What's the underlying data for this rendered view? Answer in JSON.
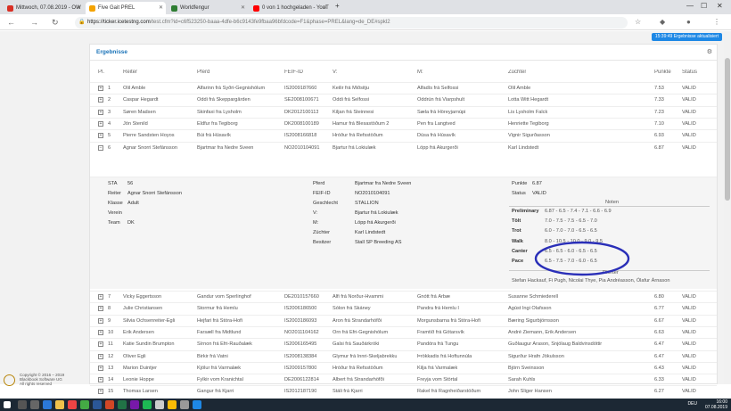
{
  "browser": {
    "tabs": [
      {
        "label": "Mittwoch, 07.08.2019 - OW",
        "color": "#d93025"
      },
      {
        "label": "Five Gait PREL",
        "color": "#f4a300",
        "active": true
      },
      {
        "label": "Worldfengur",
        "color": "#2e7d32"
      },
      {
        "label": "0 von 1 hochgeladen - YouT",
        "color": "#ff0000"
      }
    ],
    "new_tab": "+",
    "url_host": "https://ticker.icetestng.com",
    "url_path": "/test.cfm?id=c6f523250-baaa-4dfe-b6c9143fe9fbaa96bfdcode=F1&phase=PREL&lang=de_DE#spkl2",
    "back": "←",
    "forward": "→",
    "reload": "↻"
  },
  "status_badge": "15:39:49 Ergebnisse aktualisiert",
  "panel": {
    "title": "Ergebnisse",
    "gear": "⚙"
  },
  "columns": [
    "Pl.",
    "Reiter",
    "Pferd",
    "FEIF-ID",
    "V:",
    "M:",
    "Züchter",
    "Punkte",
    "Status"
  ],
  "rows_top": [
    {
      "pl": "1",
      "reiter": "Olil Amble",
      "pferd": "Álfarinn frá Syðri-Gegnishólum",
      "feif": "IS2009187660",
      "v": "Keilir frá Miðsitju",
      "m": "Álfadís frá Selfossi",
      "zuchter": "Olil Amble",
      "punkte": "7.53",
      "status": "VALID"
    },
    {
      "pl": "2",
      "reiter": "Caspar Hegardt",
      "pferd": "Oddi frá Skeppargården",
      "feif": "SE2008100671",
      "v": "Oddi frá Selfossi",
      "m": "Oddrún frá Viarpshult",
      "zuchter": "Lotta Witt Hegardt",
      "punkte": "7.33",
      "status": "VALID"
    },
    {
      "pl": "3",
      "reiter": "Søren Madsen",
      "pferd": "Skinfaxi fra Lysholm",
      "feif": "DK2012100113",
      "v": "Kiljan frá Steinnesi",
      "m": "Sæla frá Höreyjarnúpi",
      "zuchter": "Lis Lysholm Falck",
      "punkte": "7.23",
      "status": "VALID"
    },
    {
      "pl": "4",
      "reiter": "Jón Stenild",
      "pferd": "Eldfur fra Tegiborg",
      "feif": "DK2008100189",
      "v": "Hamur frá Blesastöðum 2",
      "m": "Pen fra Langtved",
      "zuchter": "Henriette Tegiborg",
      "punkte": "7.10",
      "status": "VALID"
    },
    {
      "pl": "5",
      "reiter": "Pierre Sandsten Hoyos",
      "pferd": "Búi frá Húsavík",
      "feif": "IS2008166818",
      "v": "Hróður frá Refsstöðum",
      "m": "Dúsa frá Húsavík",
      "zuchter": "Vignir Sigurðasson",
      "punkte": "6.93",
      "status": "VALID"
    },
    {
      "pl": "6",
      "reiter": "Agnar Snorri Stefánsson",
      "pferd": "Bjartmar fra Nedre Sveen",
      "feif": "NO2010104091",
      "v": "Bjartur frá Lokiulæk",
      "m": "Löpp frá Akurgerði",
      "zuchter": "Karl Lindstedt",
      "punkte": "6.87",
      "status": "VALID",
      "open": true
    }
  ],
  "detail": {
    "sta_label": "STA",
    "sta": "56",
    "reiter_label": "Reiter",
    "reiter": "Agnar Snorri Stefánsson",
    "klasse_label": "Klasse",
    "klasse": "Adult",
    "verein_label": "Verein",
    "verein": "",
    "team_label": "Team",
    "team": "DK",
    "pferd_label": "Pferd",
    "pferd": "Bjartmar fra Nedre Sveen",
    "feif_label": "FEIF-ID",
    "feif": "NO2010104091",
    "geschlecht_label": "Geschlecht",
    "geschlecht": "STALLION",
    "v_label": "V:",
    "v": "Bjartur frá Lokiulæk",
    "m_label": "M:",
    "m": "Löpp frá Akurgerði",
    "zuchter_label": "Züchter",
    "zuchter": "Karl Lindstedt",
    "besitzer_label": "Besitzer",
    "besitzer": "Stall SP Breeding AS",
    "punkte_label": "Punkte",
    "punkte": "6.87",
    "status_label": "Status",
    "status": "VALID",
    "noten": "Noten",
    "grades": [
      {
        "label": "Preliminary",
        "value": "6.87 - 6.5 - 7.4 - 7.1 - 6.6 - 6.9"
      },
      {
        "label": "Tölt",
        "value": "7.0 - 7.5 - 7.5 - 6.5 - 7.0"
      },
      {
        "label": "Trot",
        "value": "6.0 - 7.0 - 7.0 - 6.5 - 6.5"
      },
      {
        "label": "Walk",
        "value": "8.0 - 10.5 - 10.0 - 9.0 - 9.5"
      },
      {
        "label": "Canter",
        "value": "6.5 - 6.5 - 6.0 - 6.5 - 6.5"
      },
      {
        "label": "Pace",
        "value": "6.5 - 7.5 - 7.0 - 6.0 - 6.5"
      }
    ],
    "richter": "Richter",
    "judges": "Stefan Hackauf, Fi Pugh, Nicolai Thye, Pia Andréasson, Ólafur Árnason"
  },
  "rows_bottom": [
    {
      "pl": "7",
      "reiter": "Vicky Eggertsson",
      "pferd": "Gandur vom Sperlinghof",
      "feif": "DE2010157660",
      "v": "Álfi frá Norður-Hvammi",
      "m": "Gnótt frá Árbæ",
      "zuchter": "Susanne Schmiederell",
      "punkte": "6.80",
      "status": "VALID"
    },
    {
      "pl": "8",
      "reiter": "Julie Christiansen",
      "pferd": "Stormur frá Hemlu",
      "feif": "IS2006186500",
      "v": "Sólon frá Skáney",
      "m": "Pandra frá Hemlu I",
      "zuchter": "Ágúst Ingi Ólafsson",
      "punkte": "6.77",
      "status": "VALID"
    },
    {
      "pl": "9",
      "reiter": "Silvia Ochsenreiter-Egli",
      "pferd": "Hejfari frá Stóra-Hofi",
      "feif": "IS2003186093",
      "v": "Aron frá Strandarhöfði",
      "m": "Morgunsbarna frá Stóra-Hofi",
      "zuchter": "Bæring Sigurbjörnsson",
      "punkte": "6.67",
      "status": "VALID"
    },
    {
      "pl": "10",
      "reiter": "Erik Andersen",
      "pferd": "Farsæll fra Midtlund",
      "feif": "NO2011104162",
      "v": "Orn frá Efri-Gegnishólum",
      "m": "Framtíð frá Götarsvík",
      "zuchter": "André Ziemann, Erik Andersen",
      "punkte": "6.63",
      "status": "VALID"
    },
    {
      "pl": "11",
      "reiter": "Katie Sundin Brumpton",
      "pferd": "Sírnon frá Efri-Rauðalæk",
      "feif": "IS2006165495",
      "v": "Galsi frá Sauðárkróki",
      "m": "Pandóra frá Tungu",
      "zuchter": "Guðlaugur Arason, Snjólaug Baldvinsdóttir",
      "punkte": "6.47",
      "status": "VALID"
    },
    {
      "pl": "12",
      "reiter": "Oliver Egli",
      "pferd": "Birkir frá Vatni",
      "feif": "IS2008138384",
      "v": "Glymur frá Innri-Skeljabrekku",
      "m": "Þrökkadis frá Hoftunnúla",
      "zuchter": "Sigurður Hrafn Jökulsson",
      "punkte": "6.47",
      "status": "VALID"
    },
    {
      "pl": "13",
      "reiter": "Marion Duintjer",
      "pferd": "Kjölur frá Varmalæk",
      "feif": "IS2009157800",
      "v": "Hróður frá Refsstöðum",
      "m": "Kilja frá Varmalæk",
      "zuchter": "Björn Sveinsson",
      "punkte": "6.43",
      "status": "VALID"
    },
    {
      "pl": "14",
      "reiter": "Leonie Hoppe",
      "pferd": "Fylkir vom Kranichtal",
      "feif": "DE2006122814",
      "v": "Albert frá Strandarhöfði",
      "m": "Freyja vom Störtal",
      "zuchter": "Sarah Kuhls",
      "punkte": "6.33",
      "status": "VALID"
    },
    {
      "pl": "15",
      "reiter": "Thomas Larsen",
      "pferd": "Gangur frá Kjarri",
      "feif": "IS2012187190",
      "v": "Stáli frá Kjarri",
      "m": "Rakel frá Ragnheiðarstöðum",
      "zuchter": "John Sliger Hansen",
      "punkte": "6.27",
      "status": "VALID"
    }
  ],
  "copyright": [
    "Copyright © 2016 – 2019",
    "Blackbook Software UG",
    "All rights reserved"
  ],
  "taskbar": {
    "lang": "DEU",
    "time": "16:00",
    "date": "07.08.2019"
  }
}
